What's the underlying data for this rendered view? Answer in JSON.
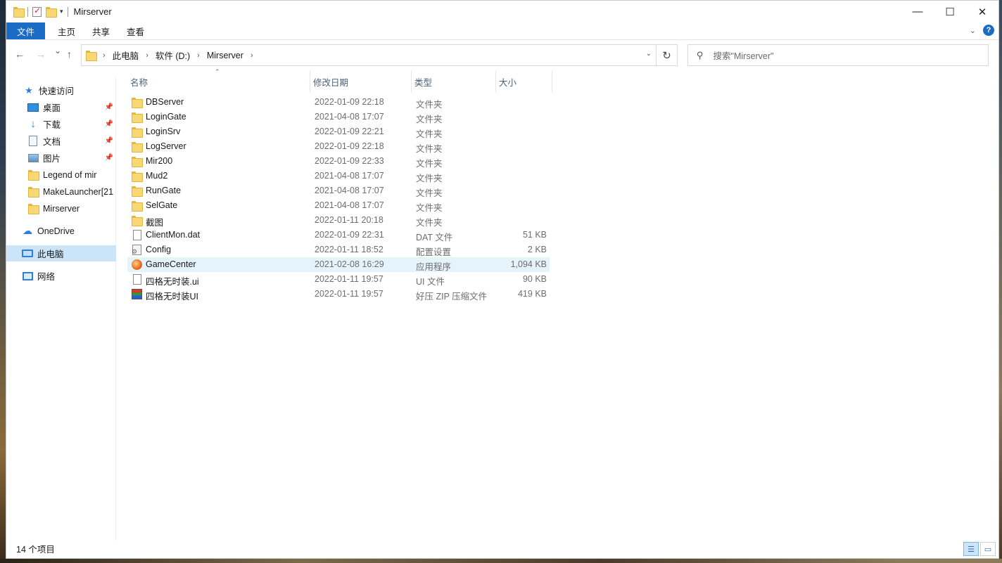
{
  "window": {
    "title": "Mirserver",
    "controls": {
      "minimize": "—",
      "maximize": "☐",
      "close": "✕"
    }
  },
  "ribbon": {
    "tabs": [
      "文件",
      "主页",
      "共享",
      "查看"
    ],
    "collapse_icon": "chevron-down-icon",
    "help_label": "?"
  },
  "nav": {
    "back": "←",
    "forward": "→",
    "recent": "⌄",
    "up": "↑",
    "breadcrumb": [
      "此电脑",
      "软件 (D:)",
      "Mirserver"
    ],
    "refresh": "↻",
    "search_placeholder": "搜索\"Mirserver\""
  },
  "sidebar": {
    "quick_access": "快速访问",
    "items": [
      {
        "label": "桌面",
        "icon": "desktop-icon",
        "pinned": true
      },
      {
        "label": "下载",
        "icon": "download-icon",
        "pinned": true
      },
      {
        "label": "文档",
        "icon": "document-icon",
        "pinned": true
      },
      {
        "label": "图片",
        "icon": "picture-icon",
        "pinned": true
      },
      {
        "label": "Legend of mir",
        "icon": "folder-icon",
        "pinned": false
      },
      {
        "label": "MakeLauncher[21",
        "icon": "folder-icon",
        "pinned": false
      },
      {
        "label": "Mirserver",
        "icon": "folder-icon",
        "pinned": false
      }
    ],
    "onedrive": "OneDrive",
    "this_pc": "此电脑",
    "network": "网络"
  },
  "columns": {
    "name": "名称",
    "date": "修改日期",
    "type": "类型",
    "size": "大小"
  },
  "files": [
    {
      "name": "DBServer",
      "date": "2022-01-09 22:18",
      "type": "文件夹",
      "size": "",
      "icon": "folder-icon"
    },
    {
      "name": "LoginGate",
      "date": "2021-04-08 17:07",
      "type": "文件夹",
      "size": "",
      "icon": "folder-icon"
    },
    {
      "name": "LoginSrv",
      "date": "2022-01-09 22:21",
      "type": "文件夹",
      "size": "",
      "icon": "folder-icon"
    },
    {
      "name": "LogServer",
      "date": "2022-01-09 22:18",
      "type": "文件夹",
      "size": "",
      "icon": "folder-icon"
    },
    {
      "name": "Mir200",
      "date": "2022-01-09 22:33",
      "type": "文件夹",
      "size": "",
      "icon": "folder-icon"
    },
    {
      "name": "Mud2",
      "date": "2021-04-08 17:07",
      "type": "文件夹",
      "size": "",
      "icon": "folder-icon"
    },
    {
      "name": "RunGate",
      "date": "2021-04-08 17:07",
      "type": "文件夹",
      "size": "",
      "icon": "folder-icon"
    },
    {
      "name": "SelGate",
      "date": "2021-04-08 17:07",
      "type": "文件夹",
      "size": "",
      "icon": "folder-icon"
    },
    {
      "name": "截图",
      "date": "2022-01-11 20:18",
      "type": "文件夹",
      "size": "",
      "icon": "folder-icon"
    },
    {
      "name": "ClientMon.dat",
      "date": "2022-01-09 22:31",
      "type": "DAT 文件",
      "size": "51 KB",
      "icon": "file-icon"
    },
    {
      "name": "Config",
      "date": "2022-01-11 18:52",
      "type": "配置设置",
      "size": "2 KB",
      "icon": "config-file-icon"
    },
    {
      "name": "GameCenter",
      "date": "2021-02-08 16:29",
      "type": "应用程序",
      "size": "1,094 KB",
      "icon": "app-icon"
    },
    {
      "name": "四格无时装.ui",
      "date": "2022-01-11 19:57",
      "type": "UI 文件",
      "size": "90 KB",
      "icon": "file-icon"
    },
    {
      "name": "四格无时装UI",
      "date": "2022-01-11 19:57",
      "type": "好压 ZIP 压缩文件",
      "size": "419 KB",
      "icon": "zip-icon"
    }
  ],
  "selected_row": 11,
  "status": {
    "count_text": "14 个项目"
  },
  "colors": {
    "accent": "#1a6cc4",
    "selection": "#cce4f7",
    "hover_row": "#e5f3fb"
  }
}
